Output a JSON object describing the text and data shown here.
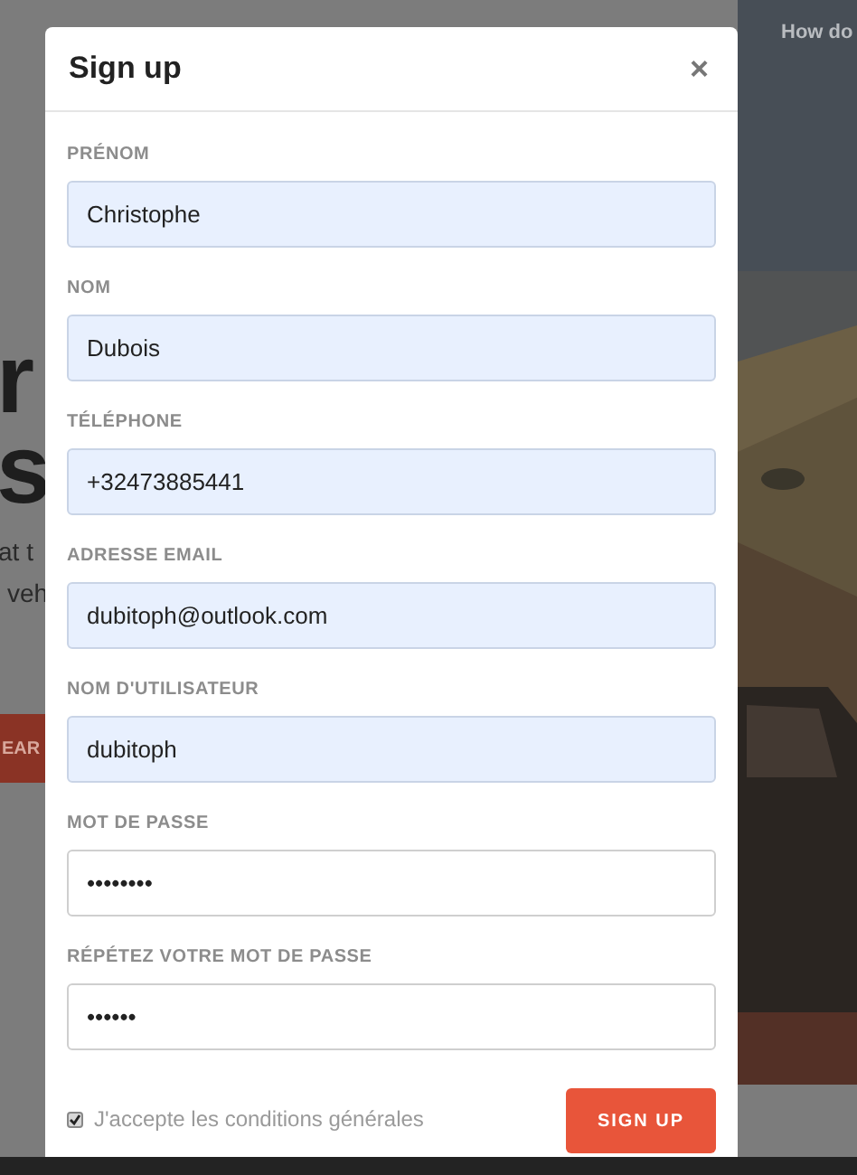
{
  "background_page": {
    "nav_link": "How do",
    "hero_title_lines": [
      "r",
      "s"
    ],
    "hero_text_lines": [
      "at t",
      "veh"
    ],
    "search_button": "EAR"
  },
  "modal": {
    "title": "Sign up",
    "close": "×",
    "fields": [
      {
        "label": "PRÉNOM",
        "value": "Christophe",
        "autofilled": true
      },
      {
        "label": "NOM",
        "value": "Dubois",
        "autofilled": true
      },
      {
        "label": "TÉLÉPHONE",
        "value": "+32473885441",
        "autofilled": true
      },
      {
        "label": "ADRESSE EMAIL",
        "value": "dubitoph@outlook.com",
        "autofilled": true
      },
      {
        "label": "NOM D'UTILISATEUR",
        "value": "dubitoph",
        "autofilled": true
      },
      {
        "label": "MOT DE PASSE",
        "value": "••••••••",
        "autofilled": false
      },
      {
        "label": "RÉPÉTEZ VOTRE MOT DE PASSE",
        "value": "••••••",
        "autofilled": false
      }
    ],
    "terms": {
      "label": "J'accepte les conditions générales",
      "checked": true
    },
    "submit": "SIGN UP"
  }
}
